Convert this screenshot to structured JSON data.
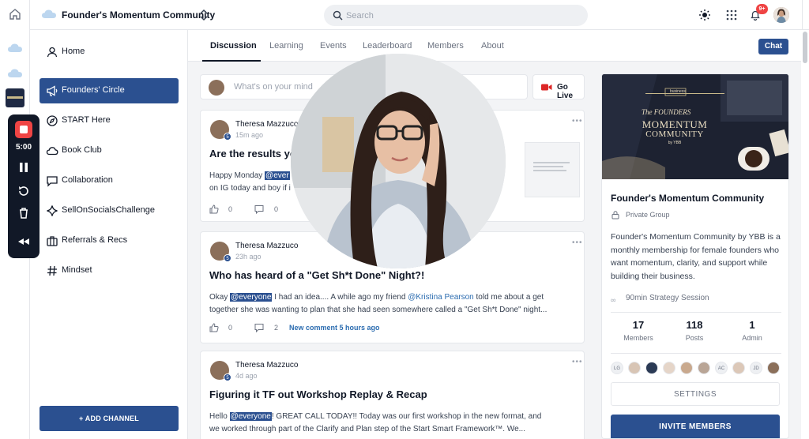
{
  "rail": {
    "recorder": {
      "time": "5:00"
    }
  },
  "topbar": {
    "community_name": "Founder's Momentum Community",
    "search_placeholder": "Search",
    "notification_count": "9+"
  },
  "sidebar": {
    "items": [
      {
        "label": "Home",
        "icon": "person-icon"
      },
      {
        "label": "Founders' Circle",
        "icon": "megaphone-icon",
        "active": true
      },
      {
        "label": "START Here",
        "icon": "compass-icon"
      },
      {
        "label": "Book Club",
        "icon": "cloud-icon"
      },
      {
        "label": "Collaboration",
        "icon": "chat-icon"
      },
      {
        "label": "SellOnSocialsChallenge",
        "icon": "sparkle-icon"
      },
      {
        "label": "Referrals & Recs",
        "icon": "briefcase-icon"
      },
      {
        "label": "Mindset",
        "icon": "hash-icon"
      }
    ],
    "add_channel": "+ ADD CHANNEL"
  },
  "tabs": [
    "Discussion",
    "Learning",
    "Events",
    "Leaderboard",
    "Members",
    "About"
  ],
  "chat_label": "Chat",
  "composer": {
    "placeholder": "What's on your mind",
    "go_live": "Go Live"
  },
  "posts": [
    {
      "author": "Theresa Mazzuco",
      "time": "15m ago",
      "title": "Are the results yo",
      "line1_pre": "Happy Monday ",
      "line1_mention": "@ever",
      "line2": "on IG today and boy if i",
      "likes": "0",
      "comments": "0"
    },
    {
      "author": "Theresa Mazzuco",
      "time": "23h ago",
      "title": "Who has heard of a \"Get Sh*t Done\" Night?!",
      "line1_pre": "Okay ",
      "line1_mention": "@everyone",
      "line1_mid": " I had an idea.... A while ago my friend ",
      "line1_link": "@Kristina Pearson",
      "line1_post": " told me about a get",
      "line2": "together she was wanting to plan that she had seen somewhere called a \"Get Sh*t Done\" night...",
      "likes": "0",
      "comments": "2",
      "new_comment": "New comment 5 hours ago"
    },
    {
      "author": "Theresa Mazzuco",
      "time": "4d ago",
      "title": "Figuring it TF out Workshop Replay & Recap",
      "line1_pre": "Hello ",
      "line1_mention": "@everyone",
      "line1_post": "! GREAT CALL TODAY!! Today was our first workshop in the new format, and",
      "line2": "we worked through part of the Clarify and Plan step of the Start Smart Framework™. We..."
    }
  ],
  "about_card": {
    "cover_title_small": "The FOUNDERS",
    "cover_title_big_1": "MOMENTUM",
    "cover_title_big_2": "COMMUNITY",
    "cover_by": "by YBB",
    "cover_tag": "business",
    "name": "Founder's Momentum Community",
    "privacy": "Private Group",
    "description": "Founder's Momentum Community by YBB is a monthly membership for female founders who want momentum, clarity, and support while building their business.",
    "session": "90min Strategy Session",
    "stats": [
      {
        "value": "17",
        "label": "Members"
      },
      {
        "value": "118",
        "label": "Posts"
      },
      {
        "value": "1",
        "label": "Admin"
      }
    ],
    "member_initials": [
      "LG",
      "AC",
      "JD"
    ],
    "settings": "SETTINGS",
    "invite": "INVITE MEMBERS"
  }
}
